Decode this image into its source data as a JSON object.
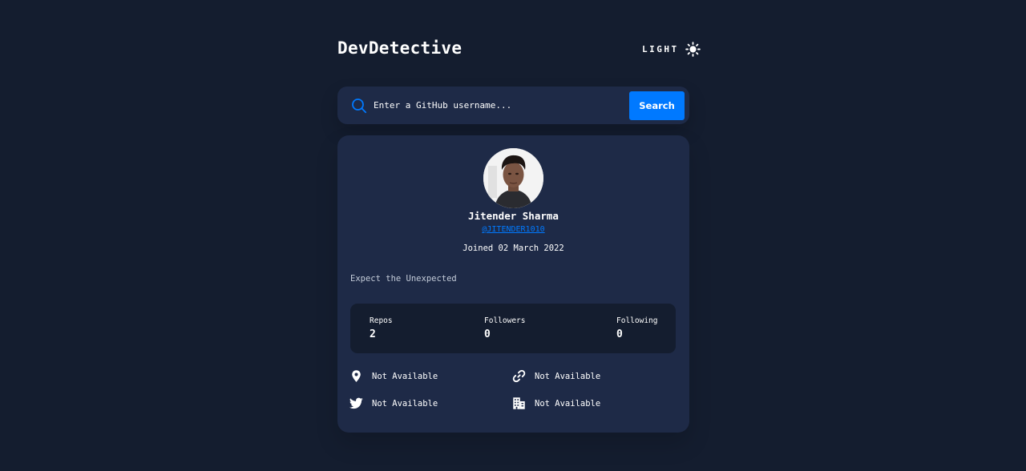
{
  "header": {
    "logo": "DevDetective",
    "theme_toggle": {
      "label": "LIGHT",
      "icon": "sun-icon"
    }
  },
  "search": {
    "icon": "search-icon",
    "placeholder": "Enter a GitHub username...",
    "value": "",
    "button_label": "Search"
  },
  "profile": {
    "avatar_alt": "avatar",
    "name": "Jitender Sharma",
    "login": "@JITENDER1010",
    "joined": "Joined 02 March 2022",
    "bio": "Expect the Unexpected",
    "stats": [
      {
        "label": "Repos",
        "value": "2"
      },
      {
        "label": "Followers",
        "value": "0"
      },
      {
        "label": "Following",
        "value": "0"
      }
    ],
    "links": [
      {
        "icon": "location-icon",
        "text": "Not Available"
      },
      {
        "icon": "link-icon",
        "text": "Not Available"
      },
      {
        "icon": "twitter-icon",
        "text": "Not Available"
      },
      {
        "icon": "company-icon",
        "text": "Not Available"
      }
    ]
  },
  "colors": {
    "background": "#141d2f",
    "card": "#1e2a47",
    "accent": "#0079ff",
    "text": "#ffffff"
  }
}
